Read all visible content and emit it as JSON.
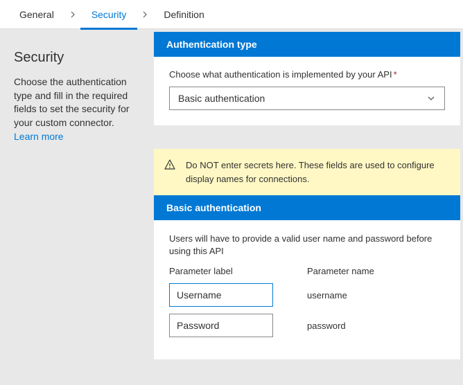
{
  "tabs": {
    "general": "General",
    "security": "Security",
    "definition": "Definition"
  },
  "sidebar": {
    "title": "Security",
    "description": "Choose the authentication type and fill in the required fields to set the security for your custom connector.",
    "learn_more": "Learn more"
  },
  "auth_type": {
    "header": "Authentication type",
    "label": "Choose what authentication is implemented by your API",
    "required_mark": "*",
    "selected": "Basic authentication"
  },
  "warning": {
    "text": "Do NOT enter secrets here. These fields are used to configure display names for connections."
  },
  "basic_auth": {
    "header": "Basic authentication",
    "description": "Users will have to provide a valid user name and password before using this API",
    "col_label": "Parameter label",
    "col_name": "Parameter name",
    "rows": [
      {
        "label": "Username",
        "name": "username"
      },
      {
        "label": "Password",
        "name": "password"
      }
    ]
  }
}
